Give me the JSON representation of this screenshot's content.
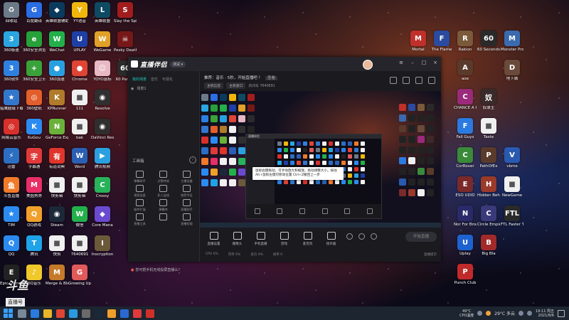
{
  "desktop": {
    "left_icons": [
      {
        "label": "回收站",
        "color": "#6c7a88",
        "glyph": "♻"
      },
      {
        "label": "百度翻译",
        "color": "#2b6de2",
        "glyph": "G"
      },
      {
        "label": "英雄联盟辅助",
        "color": "#0a3b5c",
        "glyph": "◆"
      },
      {
        "label": "YY语音",
        "color": "#f1b60b",
        "glyph": "Y"
      },
      {
        "label": "英雄联盟",
        "color": "#0f4a63",
        "glyph": "L"
      },
      {
        "label": "Slay the Spire",
        "color": "#a11d1d",
        "glyph": "S"
      },
      {
        "label": "360极速",
        "color": "#2aa5e0",
        "glyph": "3"
      },
      {
        "label": "360安全浏览器",
        "color": "#27a13a",
        "glyph": "e"
      },
      {
        "label": "WeChat",
        "color": "#23b04b",
        "glyph": "W"
      },
      {
        "label": "UPLAY",
        "color": "#1e3fa5",
        "glyph": "U"
      },
      {
        "label": "WeGame",
        "color": "#e0a128",
        "glyph": "W"
      },
      {
        "label": "Pesky Death",
        "color": "#771818",
        "glyph": "☠"
      },
      {
        "label": "360软件",
        "color": "#2d7fe0",
        "glyph": "3"
      },
      {
        "label": "360安全卫士",
        "color": "#3aa23a",
        "glyph": "+"
      },
      {
        "label": "360加速",
        "color": "#28a0e0",
        "glyph": "●"
      },
      {
        "label": "Chrome",
        "color": "#e04434",
        "glyph": "●"
      },
      {
        "label": "YOYO鼠标",
        "color": "#e8b9c4",
        "glyph": "☺"
      },
      {
        "label": "60 Parsec",
        "color": "#2b2b2b",
        "glyph": "60"
      },
      {
        "label": "猎鹰超级下载",
        "color": "#3377cc",
        "glyph": "★"
      },
      {
        "label": "360壁纸",
        "color": "#e25e2a",
        "glyph": "◎"
      },
      {
        "label": "KPRunner",
        "color": "#b07b2a",
        "glyph": "K"
      },
      {
        "label": "111",
        "color": "#f0f0f0",
        "glyph": "■"
      },
      {
        "label": "Resolve",
        "color": "#303030",
        "glyph": "◉"
      },
      {
        "label": "",
        "color": "#222",
        "glyph": ""
      },
      {
        "label": "网易云音乐",
        "color": "#d8302b",
        "glyph": "◎"
      },
      {
        "label": "KuGou",
        "color": "#2b8bf0",
        "glyph": "K"
      },
      {
        "label": "GeForce Experience",
        "color": "#6ab23a",
        "glyph": "N"
      },
      {
        "label": "bak",
        "color": "#f0f0f0",
        "glyph": "■"
      },
      {
        "label": "DaVinci Resolve",
        "color": "#2f2f2f",
        "glyph": "◉"
      },
      {
        "label": "",
        "color": "#222",
        "glyph": ""
      },
      {
        "label": "迅雷",
        "color": "#2b6ec2",
        "glyph": "⚡"
      },
      {
        "label": "字幕通",
        "color": "#e03a3a",
        "glyph": "字"
      },
      {
        "label": "有道词典",
        "color": "#e0352b",
        "glyph": "有"
      },
      {
        "label": "Word",
        "color": "#2b5fb3",
        "glyph": "W"
      },
      {
        "label": "腾讯视频",
        "color": "#2aa0e0",
        "glyph": "▶"
      },
      {
        "label": "",
        "color": "#222",
        "glyph": ""
      },
      {
        "label": "斗鱼直播",
        "color": "#f07a2a",
        "glyph": "鱼"
      },
      {
        "label": "美图秀秀",
        "color": "#e82e67",
        "glyph": "M"
      },
      {
        "label": "快剪辑",
        "color": "#f0f0f0",
        "glyph": "■"
      },
      {
        "label": "快剪辑",
        "color": "#f0f0f0",
        "glyph": "■"
      },
      {
        "label": "Crossy",
        "color": "#28b35a",
        "glyph": "C"
      },
      {
        "label": "",
        "color": "#222",
        "glyph": ""
      },
      {
        "label": "TIM",
        "color": "#2b8bf0",
        "glyph": "★"
      },
      {
        "label": "QQ游戏",
        "color": "#f0a02a",
        "glyph": "Q"
      },
      {
        "label": "Steam",
        "color": "#1b2838",
        "glyph": "◉"
      },
      {
        "label": "微信",
        "color": "#23b04b",
        "glyph": "W"
      },
      {
        "label": "Core Mana",
        "color": "#6a4bd0",
        "glyph": "◆"
      },
      {
        "label": "",
        "color": "#222",
        "glyph": ""
      },
      {
        "label": "QQ",
        "color": "#2b8bf0",
        "glyph": "Q"
      },
      {
        "label": "腾讯",
        "color": "#1ea3e8",
        "glyph": "T"
      },
      {
        "label": "快剪",
        "color": "#f0f0f0",
        "glyph": "■"
      },
      {
        "label": "7640691",
        "color": "#f0f0f0",
        "glyph": "■"
      },
      {
        "label": "Inscryption",
        "color": "#6b5a3a",
        "glyph": "I"
      },
      {
        "label": "",
        "color": "#222",
        "glyph": ""
      },
      {
        "label": "Epic Games",
        "color": "#222",
        "glyph": "E"
      },
      {
        "label": "QQ音乐",
        "color": "#f0c82a",
        "glyph": "♪"
      },
      {
        "label": "Merge & Blade",
        "color": "#c47a2a",
        "glyph": "M"
      },
      {
        "label": "Growing Up",
        "color": "#e05a5a",
        "glyph": "G"
      },
      {
        "label": "",
        "color": "#222",
        "glyph": ""
      },
      {
        "label": "",
        "color": "#222",
        "glyph": ""
      }
    ],
    "right_icons": [
      {
        "label": "Mortal",
        "color": "#c0302a",
        "glyph": "M"
      },
      {
        "label": "The Flame",
        "color": "#2a4ba0",
        "glyph": "F"
      },
      {
        "label": "Rakion",
        "color": "#7a5a3a",
        "glyph": "R"
      },
      {
        "label": "60 Seconds Reatomized",
        "color": "#2a2a2a",
        "glyph": "60"
      },
      {
        "label": "Monster Prom",
        "color": "#3a6ab0",
        "glyph": "M"
      },
      {
        "label": "",
        "color": "#222",
        "glyph": ""
      },
      {
        "label": "",
        "color": "#222",
        "glyph": ""
      },
      {
        "label": "",
        "color": "#222",
        "glyph": ""
      },
      {
        "label": "aoe",
        "color": "#5a3a2a",
        "glyph": "A"
      },
      {
        "label": "",
        "color": "#222",
        "glyph": ""
      },
      {
        "label": "地下城",
        "color": "#6a4a3a",
        "glyph": "D"
      },
      {
        "label": "",
        "color": "#222",
        "glyph": ""
      },
      {
        "label": "",
        "color": "#222",
        "glyph": ""
      },
      {
        "label": "",
        "color": "#222",
        "glyph": ""
      },
      {
        "label": "CHANCE A Humanize",
        "color": "#9a2a7a",
        "glyph": "C"
      },
      {
        "label": "奴隶主",
        "color": "#3a2a2a",
        "glyph": "奴"
      },
      {
        "label": "",
        "color": "#222",
        "glyph": ""
      },
      {
        "label": "",
        "color": "#222",
        "glyph": ""
      },
      {
        "label": "",
        "color": "#222",
        "glyph": ""
      },
      {
        "label": "",
        "color": "#222",
        "glyph": ""
      },
      {
        "label": "Fall Guys",
        "color": "#2a7ae0",
        "glyph": "F"
      },
      {
        "label": "Taste",
        "color": "#f0f0f0",
        "glyph": "■"
      },
      {
        "label": "",
        "color": "#222",
        "glyph": ""
      },
      {
        "label": "",
        "color": "#222",
        "glyph": ""
      },
      {
        "label": "",
        "color": "#222",
        "glyph": ""
      },
      {
        "label": "",
        "color": "#222",
        "glyph": ""
      },
      {
        "label": "CorRover",
        "color": "#3a8a3a",
        "glyph": "C"
      },
      {
        "label": "PathOfEx",
        "color": "#5a3a2a",
        "glyph": "P"
      },
      {
        "label": "vbme",
        "color": "#2a5ab0",
        "glyph": "V"
      },
      {
        "label": "",
        "color": "#222",
        "glyph": ""
      },
      {
        "label": "",
        "color": "#222",
        "glyph": ""
      },
      {
        "label": "",
        "color": "#222",
        "glyph": ""
      },
      {
        "label": "ESO UDID",
        "color": "#7a2a2a",
        "glyph": "E"
      },
      {
        "label": "Hidden Behind",
        "color": "#9a3a2a",
        "glyph": "H"
      },
      {
        "label": "NewGame",
        "color": "#f0f0f0",
        "glyph": "■"
      },
      {
        "label": "",
        "color": "#222",
        "glyph": ""
      },
      {
        "label": "",
        "color": "#222",
        "glyph": ""
      },
      {
        "label": "",
        "color": "#222",
        "glyph": ""
      },
      {
        "label": "Nor For Broadcast",
        "color": "#2a2a6a",
        "glyph": "N"
      },
      {
        "label": "Circle Empires",
        "color": "#3a3a7a",
        "glyph": "C"
      },
      {
        "label": "FTL Faster Than Light",
        "color": "#2a2a2a",
        "glyph": "FTL"
      },
      {
        "label": "",
        "color": "#222",
        "glyph": ""
      },
      {
        "label": "",
        "color": "#222",
        "glyph": ""
      },
      {
        "label": "",
        "color": "#222",
        "glyph": ""
      },
      {
        "label": "Uplay",
        "color": "#1e62d0",
        "glyph": "U"
      },
      {
        "label": "Big Bla",
        "color": "#a02a2a",
        "glyph": "B"
      },
      {
        "label": "",
        "color": "#222",
        "glyph": ""
      },
      {
        "label": "",
        "color": "#222",
        "glyph": ""
      },
      {
        "label": "",
        "color": "#222",
        "glyph": ""
      },
      {
        "label": "",
        "color": "#222",
        "glyph": ""
      },
      {
        "label": "Punch Club",
        "color": "#c02a2a",
        "glyph": "P"
      }
    ]
  },
  "stream_overlay": {
    "brand": "斗鱼",
    "tag": "直播号",
    "room": "7640691"
  },
  "app": {
    "name": "直播伴侣",
    "badge": "测试 ▾",
    "sidebar": {
      "tabs": [
        "我的场景",
        "音乐",
        "可视化"
      ],
      "scene_label": "场景1",
      "tools_title": "工具箱",
      "tools": [
        "弹幕助手",
        "点赞特效",
        "主播设备",
        "视频连麦",
        "多人连线",
        "推荐专区",
        "插件扩展",
        "弹幕库",
        "直播助手",
        "直播工具",
        "",
        "直播权限"
      ],
      "hint": "您可把手机无线投屏直播么？"
    },
    "main": {
      "notice": "推荐：音乐 · 5秒，开始直播吧 ！",
      "notice_tag": "查看",
      "chips": [
        "主机信息",
        "主机窗口"
      ],
      "room_info": "房间号 7640691",
      "tooltip": "鼠标右键拖动，可手动放大和缩放，拖动调整大小。按住Alt+鼠标左键可移动位置 Ctrl+Z撤回上一步",
      "controls": [
        "直播设置",
        "摄像头",
        "手机直播",
        "游戏",
        "麦克风",
        "扬声器"
      ],
      "start_button": "开始直播",
      "status": [
        "CPU 0%",
        "内存 0%",
        "丢包 0%",
        "帧率 0"
      ],
      "status_hint": "直播提示"
    }
  },
  "taskbar": {
    "apps": [
      {
        "color": "#7a8899"
      },
      {
        "color": "#2a7ae0"
      },
      {
        "color": "#e8b42a"
      },
      {
        "color": "#e04434"
      },
      {
        "color": "#2a9ae0"
      },
      {
        "color": "#6a6a6a"
      },
      {
        "color": "#1b2838"
      },
      {
        "color": "#f0a02a"
      },
      {
        "color": "#2a6ad0"
      },
      {
        "color": "#e03a3a"
      },
      {
        "color": "#d0302a"
      }
    ],
    "cpu_temp": "49°C",
    "cpu_label": "CPU温度",
    "weather": "29°C 多云",
    "time": "19:11 周五",
    "date": "2021/8/6"
  }
}
